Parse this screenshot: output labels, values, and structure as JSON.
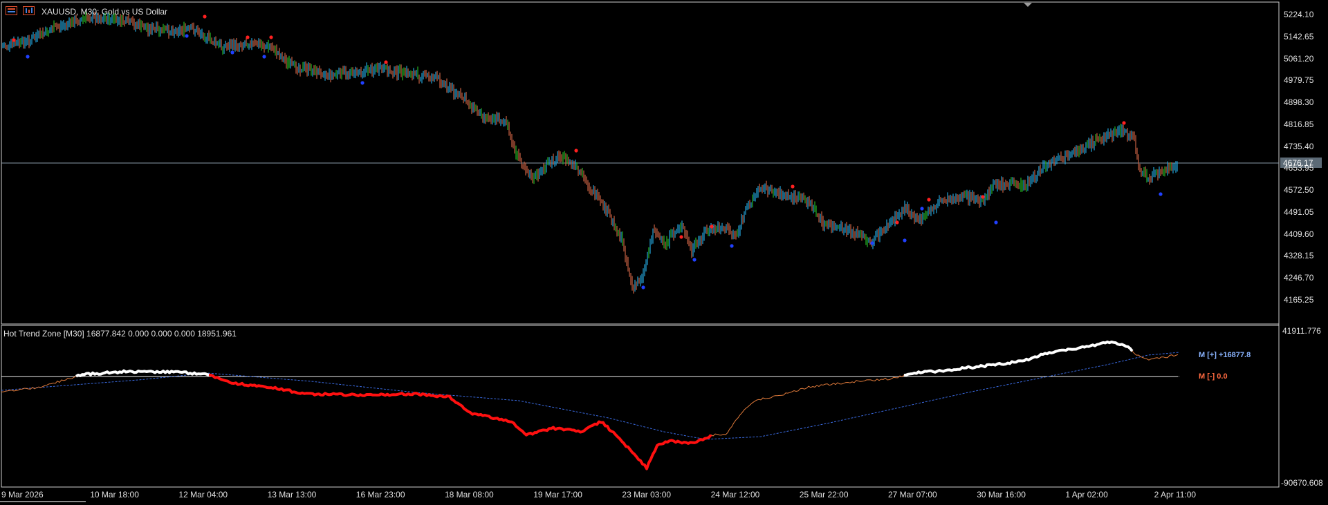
{
  "header": {
    "symbol_title": "XAUUSD, M30:  Gold vs US Dollar"
  },
  "price_axis": {
    "labels": [
      "5224.10",
      "5142.65",
      "5061.20",
      "4979.75",
      "4898.30",
      "4816.85",
      "4735.40",
      "4653.95",
      "4572.50",
      "4491.05",
      "4409.60",
      "4328.15",
      "4246.70",
      "4165.25"
    ],
    "current_price": "4676.17"
  },
  "indicator": {
    "title": "Hot Trend Zone [M30] 16877.842 0.000 0.000 0.000 18951.961",
    "max_label": "41911.776",
    "min_label": "-90670.608",
    "legend_plus": "M [+]  +16877.8",
    "legend_minus": "M [-]   0.0"
  },
  "time_axis": {
    "labels": [
      "9 Mar 2026",
      "10 Mar 18:00",
      "12 Mar 04:00",
      "13 Mar 13:00",
      "16 Mar 23:00",
      "18 Mar 08:00",
      "19 Mar 17:00",
      "23 Mar 03:00",
      "24 Mar 12:00",
      "25 Mar 22:00",
      "27 Mar 07:00",
      "30 Mar 16:00",
      "1 Apr 02:00",
      "2 Apr 11:00"
    ]
  },
  "colors": {
    "bull": "#2196c8",
    "bear": "#b85a3e",
    "neutral": "#22a822",
    "sell_marker": "#ff2020",
    "buy_marker": "#2040ff",
    "grid_line": "#ffffff",
    "osc_positive": "#ffffff",
    "osc_negative": "#ff1010",
    "osc_thin": "#e07a3a",
    "osc_signal": "#3a6ae0",
    "legend_plus": "#8ab4ff",
    "legend_minus": "#ff6a40"
  }
}
